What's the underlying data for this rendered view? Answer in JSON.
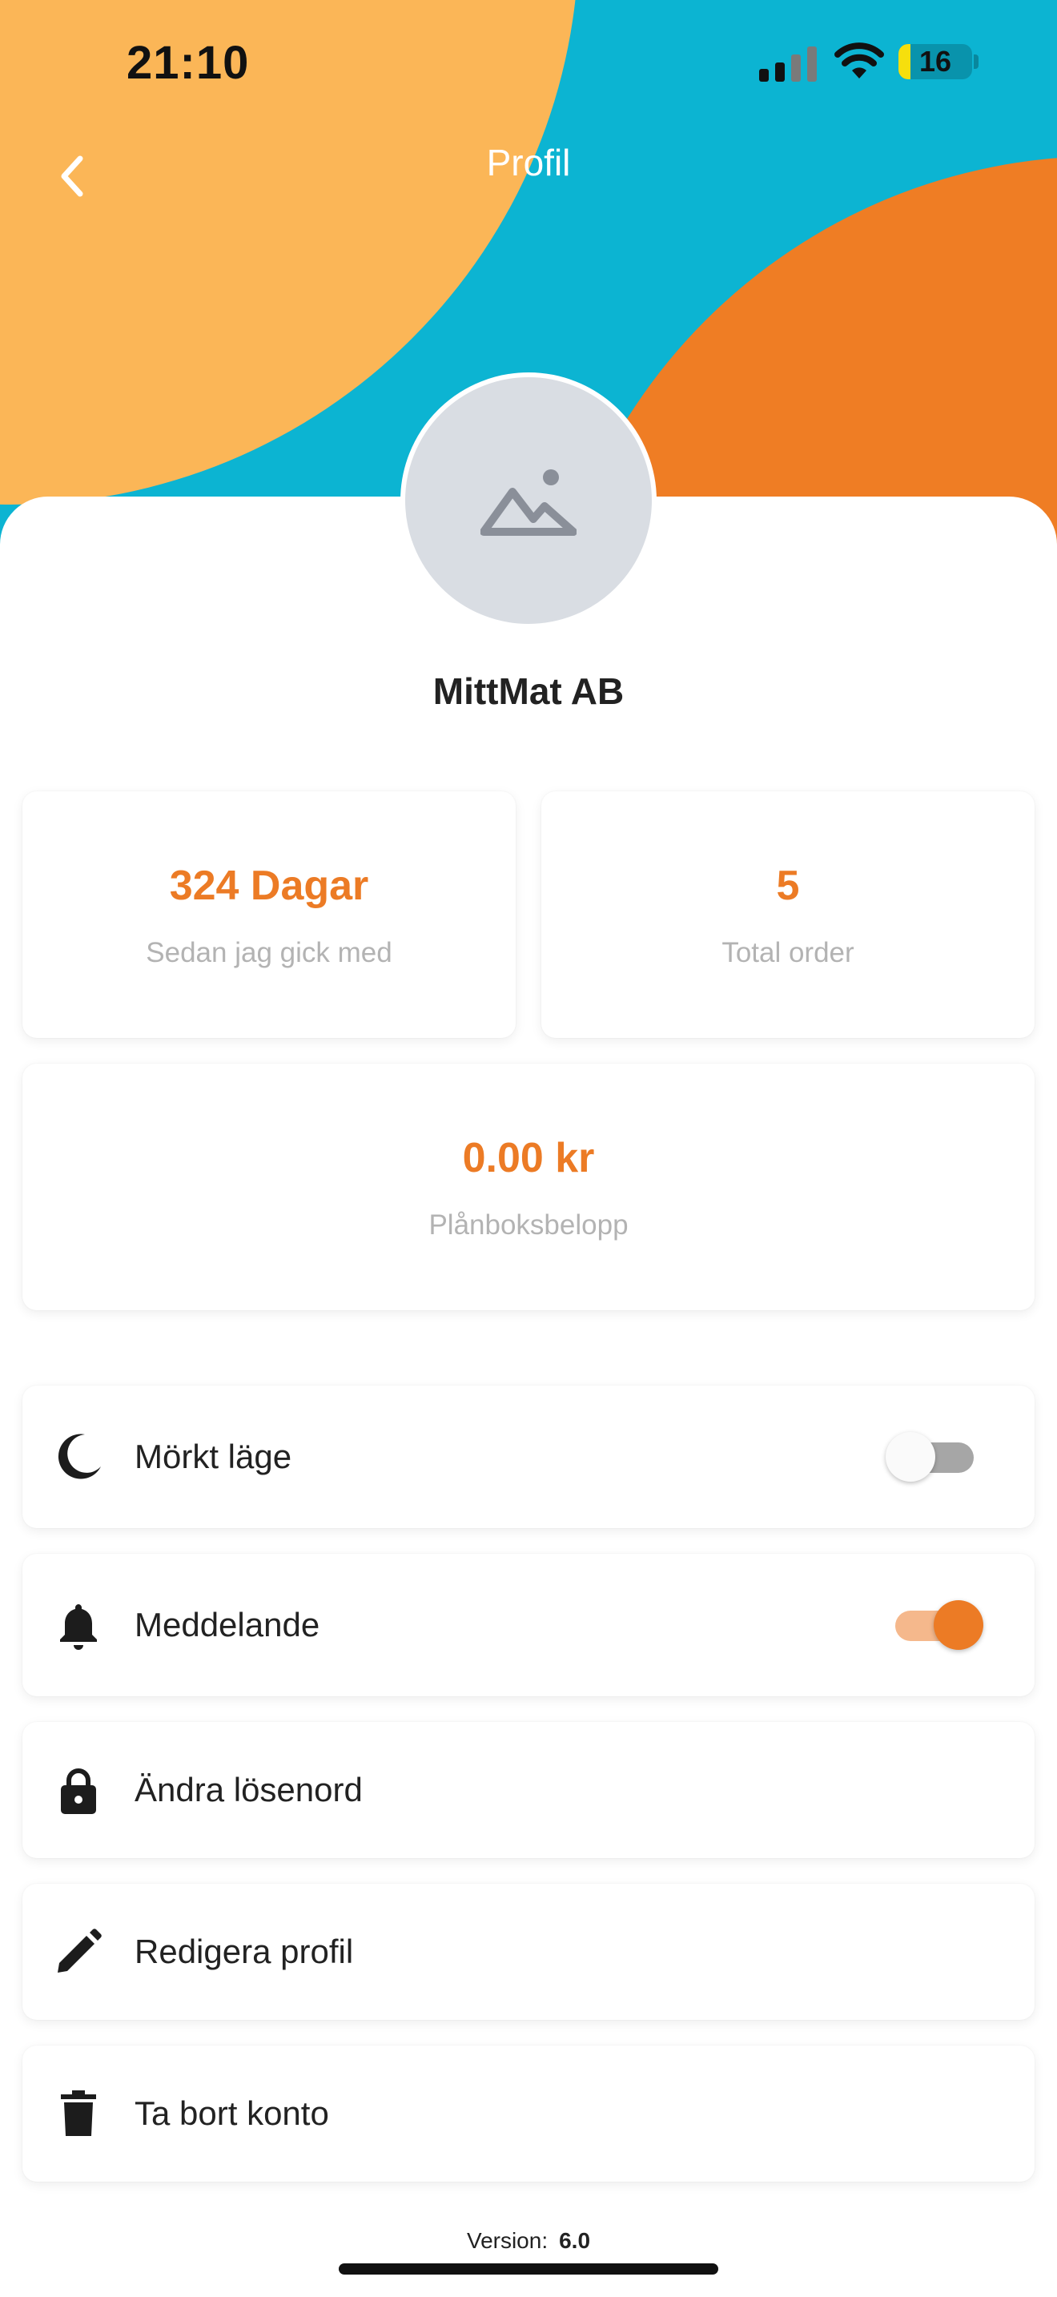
{
  "status_bar": {
    "time": "21:10",
    "battery_level": "16",
    "battery_fraction": 0.16
  },
  "header": {
    "title": "Profil",
    "back_icon": "chevron-left-icon"
  },
  "profile": {
    "name": "MittMat AB",
    "avatar_icon": "image-placeholder-icon"
  },
  "stats": {
    "days": {
      "value": "324 Dagar",
      "label": "Sedan jag gick med"
    },
    "orders": {
      "value": "5",
      "label": "Total order"
    },
    "wallet": {
      "value": "0.00 kr",
      "label": "Plånboksbelopp"
    }
  },
  "menu": {
    "items": [
      {
        "label": "Mörkt läge",
        "icon": "moon-icon",
        "toggle": false
      },
      {
        "label": "Meddelande",
        "icon": "bell-icon",
        "toggle": true
      },
      {
        "label": "Ändra lösenord",
        "icon": "lock-icon"
      },
      {
        "label": "Redigera profil",
        "icon": "pencil-icon"
      },
      {
        "label": "Ta bort konto",
        "icon": "trash-icon"
      }
    ]
  },
  "footer": {
    "version_label": "Version:",
    "version_value": "6.0"
  },
  "colors": {
    "accent": "#ec7b25",
    "header_teal": "#0cb4d2",
    "header_yellow": "#fbb657",
    "header_orange": "#ef7d24",
    "label_gray": "#b3b3b3"
  }
}
